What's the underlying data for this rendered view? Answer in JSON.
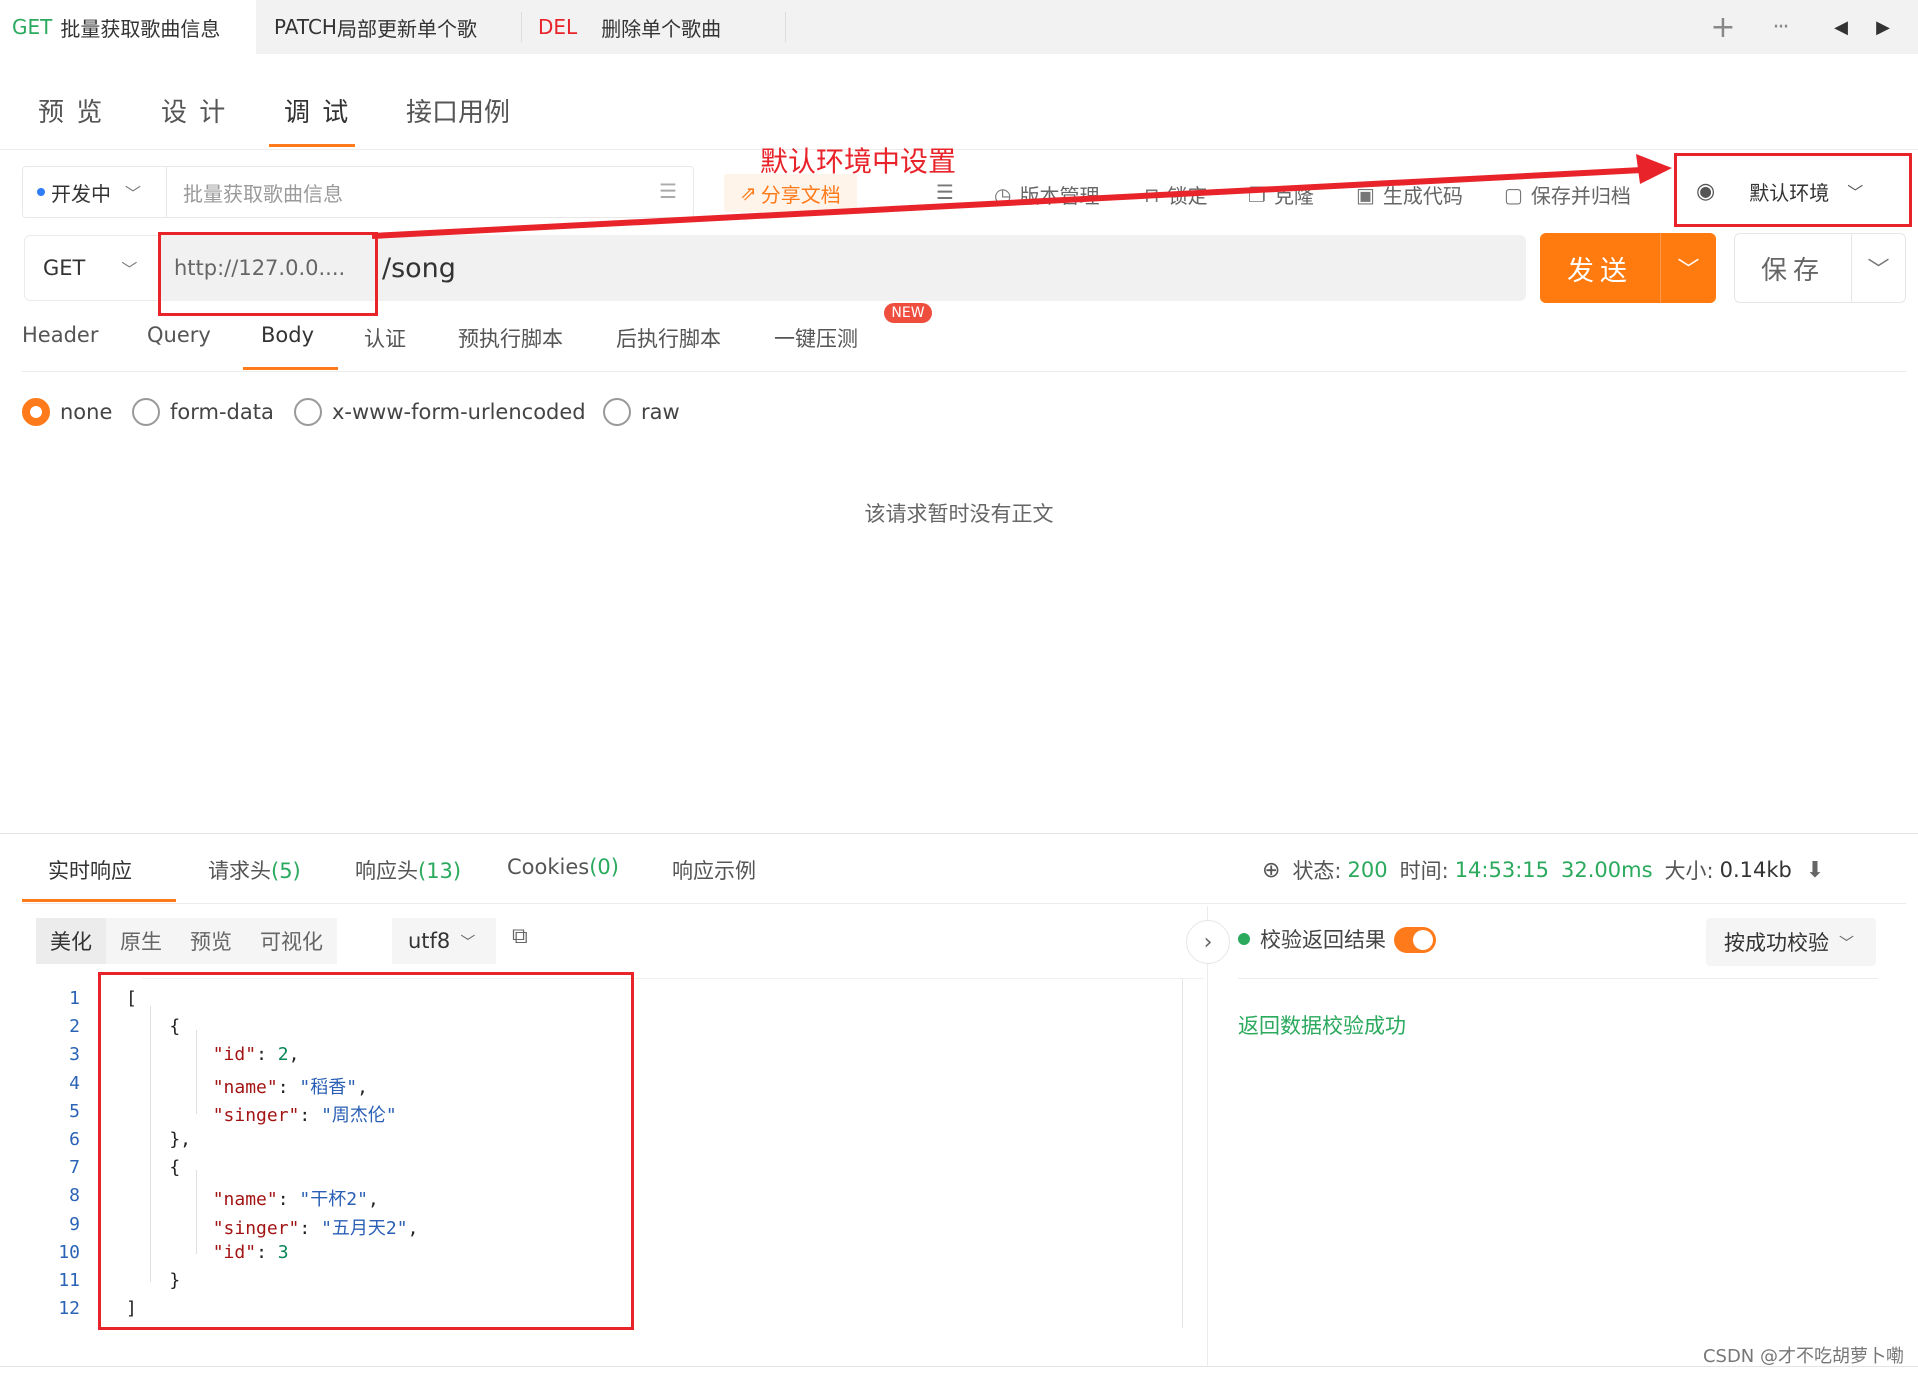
{
  "tabs": [
    {
      "method": "GET",
      "method_color": "#2baa5e",
      "name": "批量获取歌曲信息"
    },
    {
      "method": "PATCH",
      "method_color": "#333333",
      "name": "局部更新单个歌曲"
    },
    {
      "method": "DEL",
      "method_color": "#e8232a",
      "name": "删除单个歌曲"
    }
  ],
  "tab_controls": {
    "add": "+",
    "more": "···",
    "prev": "◀",
    "next": "▶"
  },
  "nav_tabs": [
    "预 览",
    "设 计",
    "调 试",
    "接口用例"
  ],
  "toolbar": {
    "env_name": "开发中",
    "api_name_placeholder": "批量获取歌曲信息",
    "share_doc": "分享文档",
    "items": [
      "版本管理",
      "锁定",
      "克隆",
      "生成代码",
      "保存并归档"
    ],
    "default_env": "默认环境"
  },
  "url_row": {
    "method": "GET",
    "base_url": "http://127.0.0....",
    "path": "/song",
    "send_label": "发送",
    "save_label": "保存"
  },
  "request_tabs": [
    "Header",
    "Query",
    "Body",
    "认证",
    "预执行脚本",
    "后执行脚本",
    "一键压测"
  ],
  "new_badge": "NEW",
  "body_types": [
    "none",
    "form-data",
    "x-www-form-urlencoded",
    "raw"
  ],
  "body_selected": "none",
  "empty_body_text": "该请求暂时没有正文",
  "response": {
    "tabs": [
      {
        "label": "实时响应",
        "count": ""
      },
      {
        "label": "请求头",
        "count": "(5)"
      },
      {
        "label": "响应头",
        "count": "(13)"
      },
      {
        "label": "Cookies",
        "count": "(0)"
      },
      {
        "label": "响应示例",
        "count": ""
      }
    ],
    "status_label": "状态:",
    "status": "200",
    "time_label": "时间:",
    "time": "14:53:15",
    "duration": "32.00ms",
    "size_label": "大小:",
    "size": "0.14kb",
    "formats": [
      "美化",
      "原生",
      "预览",
      "可视化"
    ],
    "encoding": "utf8",
    "code_lines": [
      "[",
      "    {",
      "        \"id\": 2,",
      "        \"name\": \"稻香\",",
      "        \"singer\": \"周杰伦\"",
      "    },",
      "    {",
      "        \"name\": \"干杯2\",",
      "        \"singer\": \"五月天2\",",
      "        \"id\": 3",
      "    }",
      "]"
    ],
    "verify_label": "校验返回结果",
    "verify_mode": "按成功校验",
    "verify_result": "返回数据校验成功"
  },
  "annotation": {
    "text": "默认环境中设置",
    "color": "#e8232a"
  },
  "watermark": "CSDN @才不吃胡萝卜嘞"
}
